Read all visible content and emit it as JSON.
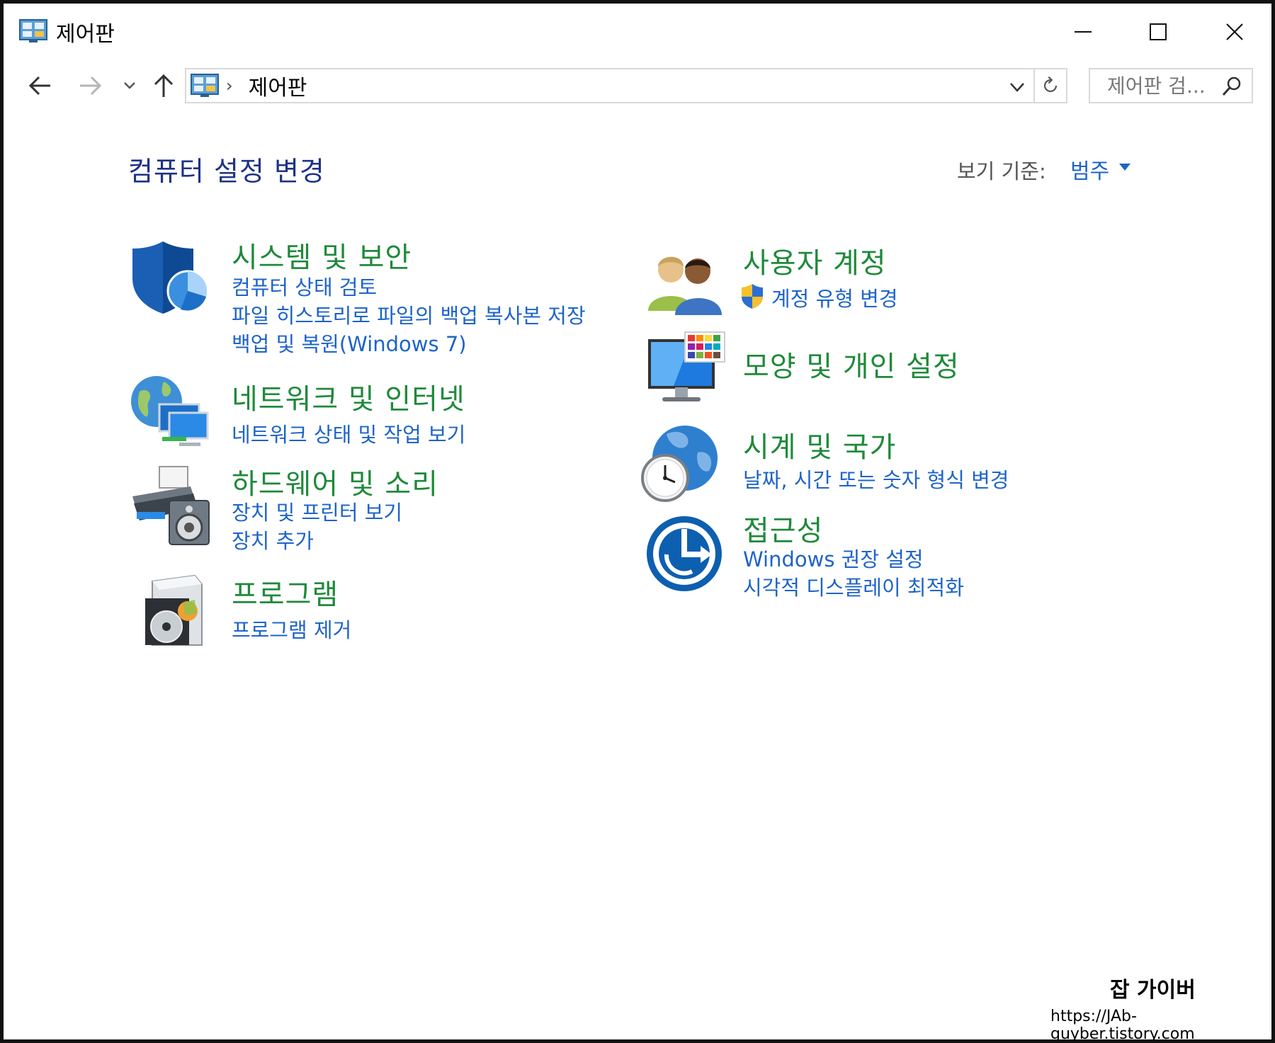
{
  "window": {
    "title": "제어판"
  },
  "nav": {
    "address_text": "제어판",
    "search_placeholder": "제어판 검..."
  },
  "header": {
    "title": "컴퓨터 설정 변경",
    "view_by_label": "보기 기준:",
    "view_by_value": "범주"
  },
  "categories": {
    "system_security": {
      "title": "시스템 및 보안",
      "links": [
        "컴퓨터 상태 검토",
        "파일 히스토리로 파일의 백업 복사본 저장",
        "백업 및 복원(Windows 7)"
      ]
    },
    "network": {
      "title": "네트워크 및 인터넷",
      "links": [
        "네트워크 상태 및 작업 보기"
      ]
    },
    "hardware": {
      "title": "하드웨어 및 소리",
      "links": [
        "장치 및 프린터 보기",
        "장치 추가"
      ]
    },
    "programs": {
      "title": "프로그램",
      "links": [
        "프로그램 제거"
      ]
    },
    "user_accounts": {
      "title": "사용자 계정",
      "links": [
        "계정 유형 변경"
      ]
    },
    "appearance": {
      "title": "모양 및 개인 설정",
      "links": []
    },
    "clock_region": {
      "title": "시계 및 국가",
      "links": [
        "날짜, 시간 또는 숫자 형식 변경"
      ]
    },
    "accessibility": {
      "title": "접근성",
      "links": [
        "Windows 권장 설정",
        "시각적 디스플레이 최적화"
      ]
    }
  },
  "watermark": {
    "title": "잡 가이버",
    "url": "https://JAb-guyber.tistory.com"
  },
  "colors": {
    "category_title": "#1f8a3a",
    "link": "#1e64c8",
    "page_title": "#1e3287"
  },
  "icons": [
    "control-panel-icon",
    "minimize-icon",
    "maximize-icon",
    "close-icon",
    "back-arrow-icon",
    "forward-arrow-icon",
    "recent-locations-icon",
    "up-arrow-icon",
    "chevron-down-icon",
    "refresh-icon",
    "search-icon",
    "shield-icon",
    "network-icon",
    "printer-icon",
    "programs-icon",
    "users-icon",
    "display-icon",
    "clock-globe-icon",
    "accessibility-icon",
    "uac-shield-icon"
  ]
}
